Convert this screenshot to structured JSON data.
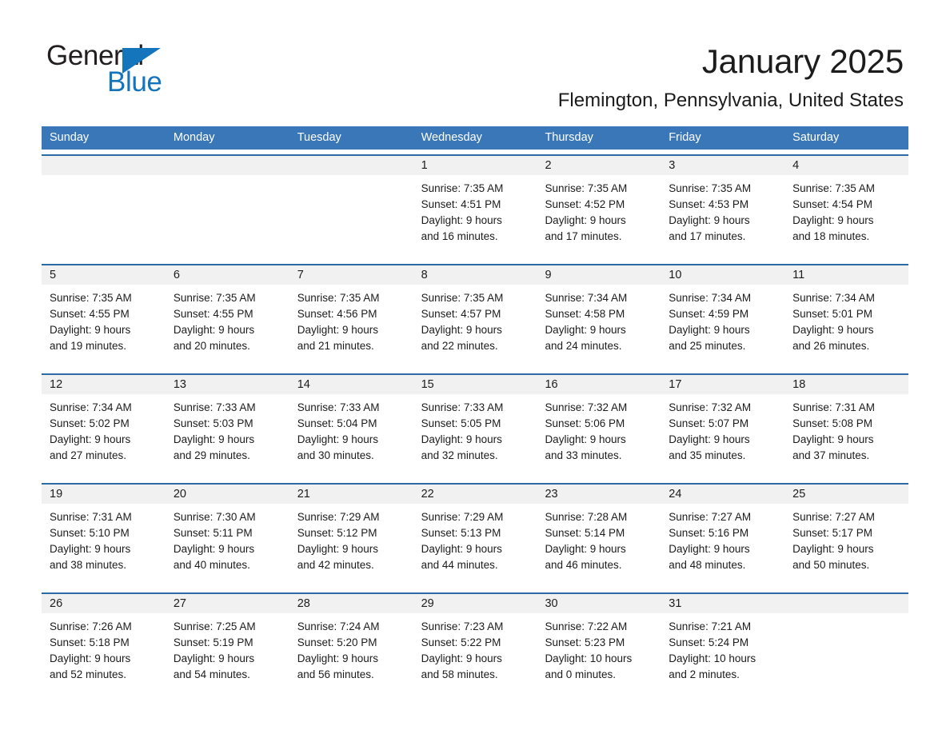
{
  "brand": {
    "line1": "General",
    "line2": "Blue",
    "accent_color": "#1474bc",
    "triangle_icon": "triangle-icon"
  },
  "header": {
    "title": "January 2025",
    "location": "Flemington, Pennsylvania, United States"
  },
  "calendar": {
    "header_bg": "#3a77b8",
    "row_divider_color": "#2f6aa8",
    "daynum_bg": "#f1f1f1",
    "day_names": [
      "Sunday",
      "Monday",
      "Tuesday",
      "Wednesday",
      "Thursday",
      "Friday",
      "Saturday"
    ],
    "weeks": [
      [
        {
          "day": "",
          "empty": true,
          "sunrise": "",
          "sunset": "",
          "daylight1": "",
          "daylight2": ""
        },
        {
          "day": "",
          "empty": true,
          "sunrise": "",
          "sunset": "",
          "daylight1": "",
          "daylight2": ""
        },
        {
          "day": "",
          "empty": true,
          "sunrise": "",
          "sunset": "",
          "daylight1": "",
          "daylight2": ""
        },
        {
          "day": "1",
          "empty": false,
          "sunrise": "Sunrise: 7:35 AM",
          "sunset": "Sunset: 4:51 PM",
          "daylight1": "Daylight: 9 hours",
          "daylight2": "and 16 minutes."
        },
        {
          "day": "2",
          "empty": false,
          "sunrise": "Sunrise: 7:35 AM",
          "sunset": "Sunset: 4:52 PM",
          "daylight1": "Daylight: 9 hours",
          "daylight2": "and 17 minutes."
        },
        {
          "day": "3",
          "empty": false,
          "sunrise": "Sunrise: 7:35 AM",
          "sunset": "Sunset: 4:53 PM",
          "daylight1": "Daylight: 9 hours",
          "daylight2": "and 17 minutes."
        },
        {
          "day": "4",
          "empty": false,
          "sunrise": "Sunrise: 7:35 AM",
          "sunset": "Sunset: 4:54 PM",
          "daylight1": "Daylight: 9 hours",
          "daylight2": "and 18 minutes."
        }
      ],
      [
        {
          "day": "5",
          "empty": false,
          "sunrise": "Sunrise: 7:35 AM",
          "sunset": "Sunset: 4:55 PM",
          "daylight1": "Daylight: 9 hours",
          "daylight2": "and 19 minutes."
        },
        {
          "day": "6",
          "empty": false,
          "sunrise": "Sunrise: 7:35 AM",
          "sunset": "Sunset: 4:55 PM",
          "daylight1": "Daylight: 9 hours",
          "daylight2": "and 20 minutes."
        },
        {
          "day": "7",
          "empty": false,
          "sunrise": "Sunrise: 7:35 AM",
          "sunset": "Sunset: 4:56 PM",
          "daylight1": "Daylight: 9 hours",
          "daylight2": "and 21 minutes."
        },
        {
          "day": "8",
          "empty": false,
          "sunrise": "Sunrise: 7:35 AM",
          "sunset": "Sunset: 4:57 PM",
          "daylight1": "Daylight: 9 hours",
          "daylight2": "and 22 minutes."
        },
        {
          "day": "9",
          "empty": false,
          "sunrise": "Sunrise: 7:34 AM",
          "sunset": "Sunset: 4:58 PM",
          "daylight1": "Daylight: 9 hours",
          "daylight2": "and 24 minutes."
        },
        {
          "day": "10",
          "empty": false,
          "sunrise": "Sunrise: 7:34 AM",
          "sunset": "Sunset: 4:59 PM",
          "daylight1": "Daylight: 9 hours",
          "daylight2": "and 25 minutes."
        },
        {
          "day": "11",
          "empty": false,
          "sunrise": "Sunrise: 7:34 AM",
          "sunset": "Sunset: 5:01 PM",
          "daylight1": "Daylight: 9 hours",
          "daylight2": "and 26 minutes."
        }
      ],
      [
        {
          "day": "12",
          "empty": false,
          "sunrise": "Sunrise: 7:34 AM",
          "sunset": "Sunset: 5:02 PM",
          "daylight1": "Daylight: 9 hours",
          "daylight2": "and 27 minutes."
        },
        {
          "day": "13",
          "empty": false,
          "sunrise": "Sunrise: 7:33 AM",
          "sunset": "Sunset: 5:03 PM",
          "daylight1": "Daylight: 9 hours",
          "daylight2": "and 29 minutes."
        },
        {
          "day": "14",
          "empty": false,
          "sunrise": "Sunrise: 7:33 AM",
          "sunset": "Sunset: 5:04 PM",
          "daylight1": "Daylight: 9 hours",
          "daylight2": "and 30 minutes."
        },
        {
          "day": "15",
          "empty": false,
          "sunrise": "Sunrise: 7:33 AM",
          "sunset": "Sunset: 5:05 PM",
          "daylight1": "Daylight: 9 hours",
          "daylight2": "and 32 minutes."
        },
        {
          "day": "16",
          "empty": false,
          "sunrise": "Sunrise: 7:32 AM",
          "sunset": "Sunset: 5:06 PM",
          "daylight1": "Daylight: 9 hours",
          "daylight2": "and 33 minutes."
        },
        {
          "day": "17",
          "empty": false,
          "sunrise": "Sunrise: 7:32 AM",
          "sunset": "Sunset: 5:07 PM",
          "daylight1": "Daylight: 9 hours",
          "daylight2": "and 35 minutes."
        },
        {
          "day": "18",
          "empty": false,
          "sunrise": "Sunrise: 7:31 AM",
          "sunset": "Sunset: 5:08 PM",
          "daylight1": "Daylight: 9 hours",
          "daylight2": "and 37 minutes."
        }
      ],
      [
        {
          "day": "19",
          "empty": false,
          "sunrise": "Sunrise: 7:31 AM",
          "sunset": "Sunset: 5:10 PM",
          "daylight1": "Daylight: 9 hours",
          "daylight2": "and 38 minutes."
        },
        {
          "day": "20",
          "empty": false,
          "sunrise": "Sunrise: 7:30 AM",
          "sunset": "Sunset: 5:11 PM",
          "daylight1": "Daylight: 9 hours",
          "daylight2": "and 40 minutes."
        },
        {
          "day": "21",
          "empty": false,
          "sunrise": "Sunrise: 7:29 AM",
          "sunset": "Sunset: 5:12 PM",
          "daylight1": "Daylight: 9 hours",
          "daylight2": "and 42 minutes."
        },
        {
          "day": "22",
          "empty": false,
          "sunrise": "Sunrise: 7:29 AM",
          "sunset": "Sunset: 5:13 PM",
          "daylight1": "Daylight: 9 hours",
          "daylight2": "and 44 minutes."
        },
        {
          "day": "23",
          "empty": false,
          "sunrise": "Sunrise: 7:28 AM",
          "sunset": "Sunset: 5:14 PM",
          "daylight1": "Daylight: 9 hours",
          "daylight2": "and 46 minutes."
        },
        {
          "day": "24",
          "empty": false,
          "sunrise": "Sunrise: 7:27 AM",
          "sunset": "Sunset: 5:16 PM",
          "daylight1": "Daylight: 9 hours",
          "daylight2": "and 48 minutes."
        },
        {
          "day": "25",
          "empty": false,
          "sunrise": "Sunrise: 7:27 AM",
          "sunset": "Sunset: 5:17 PM",
          "daylight1": "Daylight: 9 hours",
          "daylight2": "and 50 minutes."
        }
      ],
      [
        {
          "day": "26",
          "empty": false,
          "sunrise": "Sunrise: 7:26 AM",
          "sunset": "Sunset: 5:18 PM",
          "daylight1": "Daylight: 9 hours",
          "daylight2": "and 52 minutes."
        },
        {
          "day": "27",
          "empty": false,
          "sunrise": "Sunrise: 7:25 AM",
          "sunset": "Sunset: 5:19 PM",
          "daylight1": "Daylight: 9 hours",
          "daylight2": "and 54 minutes."
        },
        {
          "day": "28",
          "empty": false,
          "sunrise": "Sunrise: 7:24 AM",
          "sunset": "Sunset: 5:20 PM",
          "daylight1": "Daylight: 9 hours",
          "daylight2": "and 56 minutes."
        },
        {
          "day": "29",
          "empty": false,
          "sunrise": "Sunrise: 7:23 AM",
          "sunset": "Sunset: 5:22 PM",
          "daylight1": "Daylight: 9 hours",
          "daylight2": "and 58 minutes."
        },
        {
          "day": "30",
          "empty": false,
          "sunrise": "Sunrise: 7:22 AM",
          "sunset": "Sunset: 5:23 PM",
          "daylight1": "Daylight: 10 hours",
          "daylight2": "and 0 minutes."
        },
        {
          "day": "31",
          "empty": false,
          "sunrise": "Sunrise: 7:21 AM",
          "sunset": "Sunset: 5:24 PM",
          "daylight1": "Daylight: 10 hours",
          "daylight2": "and 2 minutes."
        },
        {
          "day": "",
          "empty": true,
          "sunrise": "",
          "sunset": "",
          "daylight1": "",
          "daylight2": ""
        }
      ]
    ]
  }
}
